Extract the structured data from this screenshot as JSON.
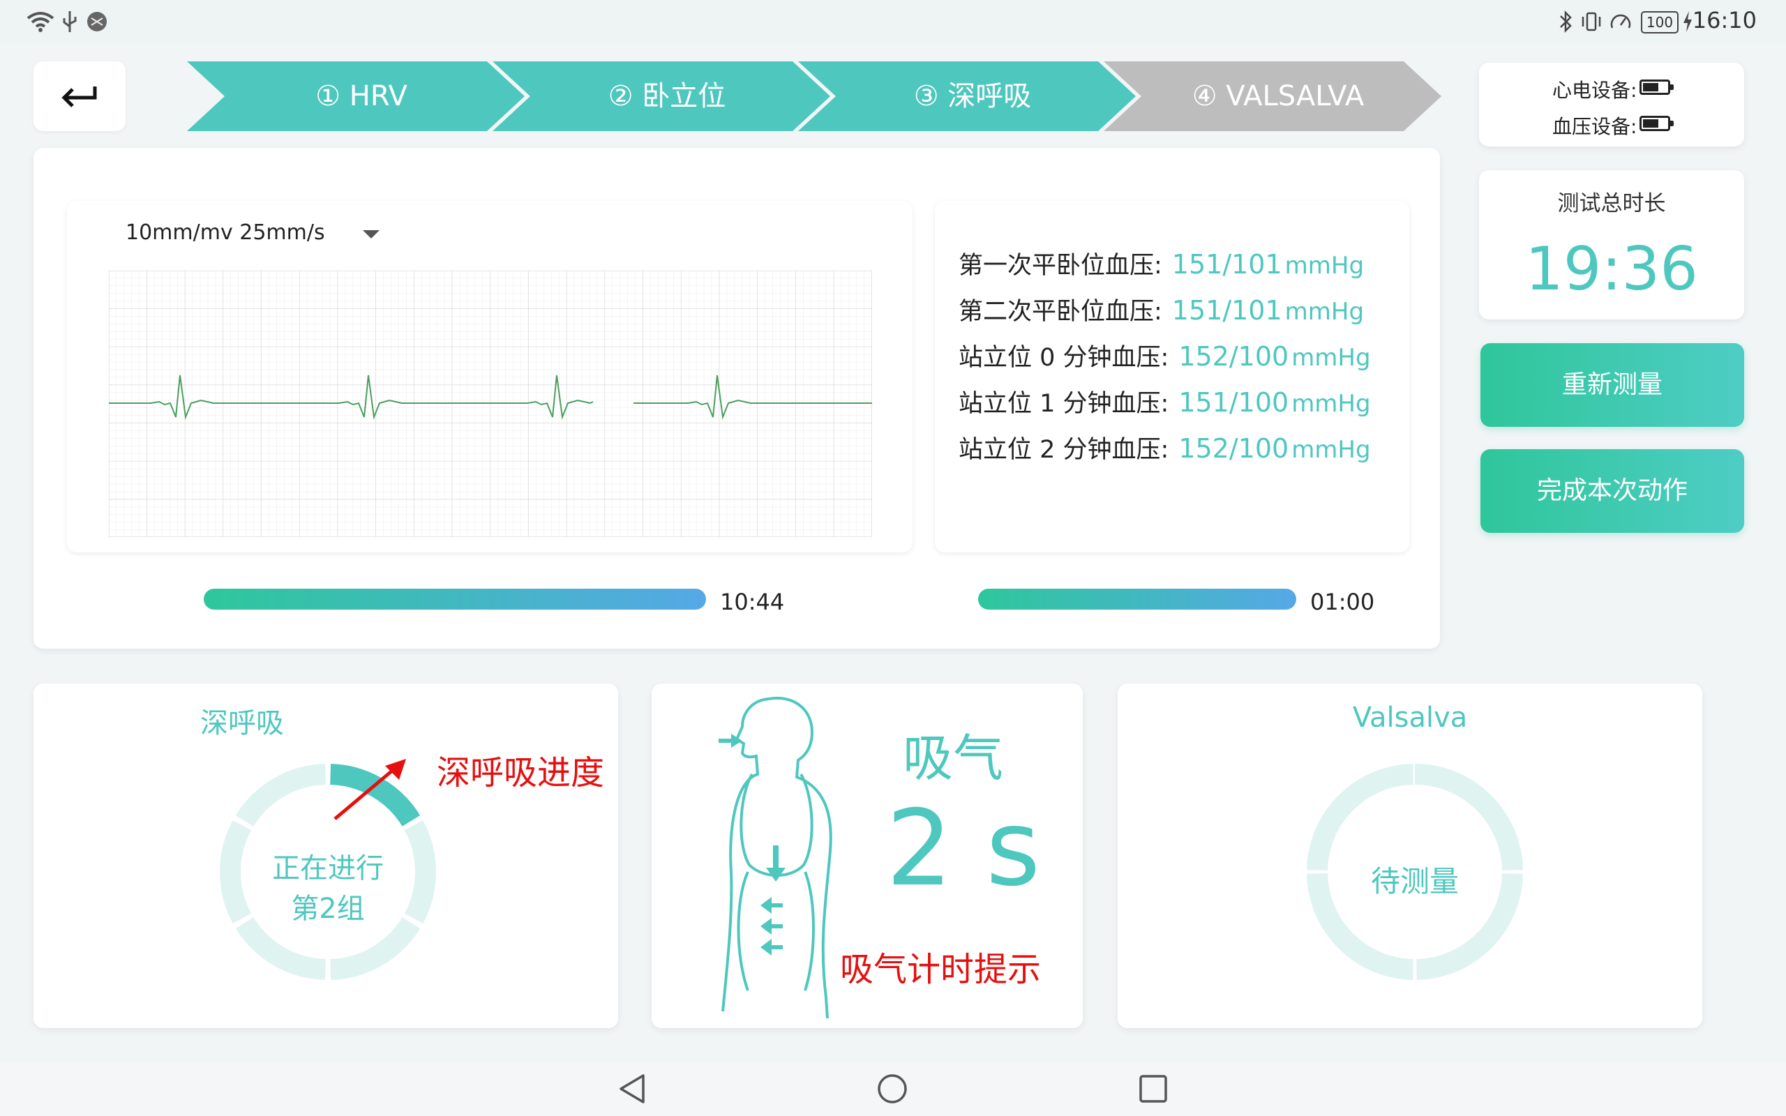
{
  "status": {
    "time": "16:10",
    "battery": "100"
  },
  "steps": [
    {
      "label": "① HRV",
      "state": "done"
    },
    {
      "label": "② 卧立位",
      "state": "done"
    },
    {
      "label": "③ 深呼吸",
      "state": "done"
    },
    {
      "label": "④ VALSALVA",
      "state": "pending"
    }
  ],
  "devices": {
    "ecg_label": "心电设备:",
    "bp_label": "血压设备:"
  },
  "total": {
    "label": "测试总时长",
    "value": "19:36"
  },
  "buttons": {
    "remeasure": "重新测量",
    "complete": "完成本次动作"
  },
  "ecg": {
    "speed": "10mm/mv 25mm/s"
  },
  "bp": [
    {
      "label": "第一次平卧位血压:",
      "value": "151/101",
      "unit": "mmHg"
    },
    {
      "label": "第二次平卧位血压:",
      "value": "151/101",
      "unit": "mmHg"
    },
    {
      "label": "站立位 0 分钟血压:",
      "value": "152/100",
      "unit": "mmHg"
    },
    {
      "label": "站立位 1 分钟血压:",
      "value": "151/100",
      "unit": "mmHg"
    },
    {
      "label": "站立位 2 分钟血压:",
      "value": "152/100",
      "unit": "mmHg"
    }
  ],
  "progress": [
    {
      "time": "10:44",
      "fraction": 1.0
    },
    {
      "time": "01:00",
      "fraction": 1.0
    }
  ],
  "deep_breath": {
    "title": "深呼吸",
    "status_line1": "正在进行",
    "status_line2": "第2组",
    "annotation": "深呼吸进度",
    "segments_total": 6,
    "segments_done": 1
  },
  "breath": {
    "phase": "吸气",
    "count": "2 s",
    "annotation": "吸气计时提示"
  },
  "valsalva": {
    "title": "Valsalva",
    "status": "待测量"
  },
  "colors": {
    "accent": "#4ec7bf",
    "step_active": "#4ec7bf",
    "step_pending": "#bdbdbd",
    "annotation": "#e60f0f"
  }
}
